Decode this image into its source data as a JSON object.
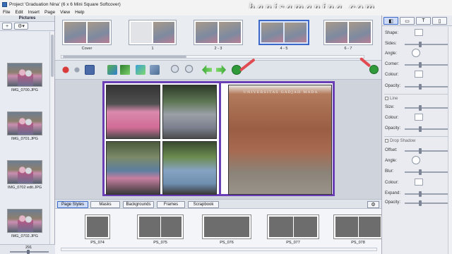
{
  "window": {
    "title": "Project 'Graduation Nina' (6 x 6 Mini Square Softcover)"
  },
  "watermark": "hanisamanina.com",
  "menu": [
    "File",
    "Edit",
    "Insert",
    "Page",
    "View",
    "Help"
  ],
  "pictures_panel": {
    "header": "Pictures",
    "add_label": "+",
    "settings_label": "⚙▾",
    "items": [
      {
        "label": "IMG_0700.JPG"
      },
      {
        "label": "IMG_0701.JPG"
      },
      {
        "label": "IMG_0702 edit.JPG"
      },
      {
        "label": "IMG_0702.JPG"
      }
    ],
    "count": "291"
  },
  "pages": [
    {
      "label": "Cover",
      "selected": false
    },
    {
      "label": "1",
      "selected": false
    },
    {
      "label": "2 - 3",
      "selected": false
    },
    {
      "label": "4 - 5",
      "selected": true
    },
    {
      "label": "6 - 7",
      "selected": false
    }
  ],
  "toolbar": {
    "tools": [
      "record-icon",
      "undo-icon",
      "save-icon",
      "add-page-icon",
      "add-text-icon",
      "add-image-icon",
      "photo-edit-icon",
      "zoom-out-icon",
      "zoom-in-icon",
      "previous-arrow-icon",
      "next-arrow-icon",
      "next-page-icon"
    ],
    "cart_icon": "shopping-cart-icon"
  },
  "canvas": {
    "building_sign": "UNIVERSITAS GADJAH MADA"
  },
  "bottom_tabs": [
    {
      "label": "Page Styles",
      "active": true
    },
    {
      "label": "Masks",
      "active": false
    },
    {
      "label": "Backgrounds",
      "active": false
    },
    {
      "label": "Frames",
      "active": false
    },
    {
      "label": "Scrapbook",
      "active": false
    }
  ],
  "page_styles": [
    {
      "label": "PS_074"
    },
    {
      "label": "PS_075"
    },
    {
      "label": "PS_076"
    },
    {
      "label": "PS_077"
    },
    {
      "label": "PS_078"
    }
  ],
  "properties": {
    "tabs": [
      "shape-icon",
      "frame-icon",
      "text-icon",
      "page-icon"
    ],
    "shape_label": "Shape:",
    "sides_label": "Sides:",
    "angle_label": "Angle:",
    "corner_label": "Corner:",
    "colour_label": "Colour:",
    "opacity_label": "Opacity:",
    "line_label": "Line",
    "size_label": "Size:",
    "line_colour_label": "Colour:",
    "line_opacity_label": "Opacity:",
    "shadow_label": "Drop Shadow",
    "offset_label": "Offset:",
    "shadow_angle_label": "Angle:",
    "blur_label": "Blur:",
    "shadow_colour_label": "Colour:",
    "expand_label": "Expand:",
    "shadow_opacity_label": "Opacity:"
  },
  "colors": {
    "selection_frame": "#6a3fb6",
    "annotation_arrow": "#e04a50",
    "accent": "#3c69c7"
  }
}
